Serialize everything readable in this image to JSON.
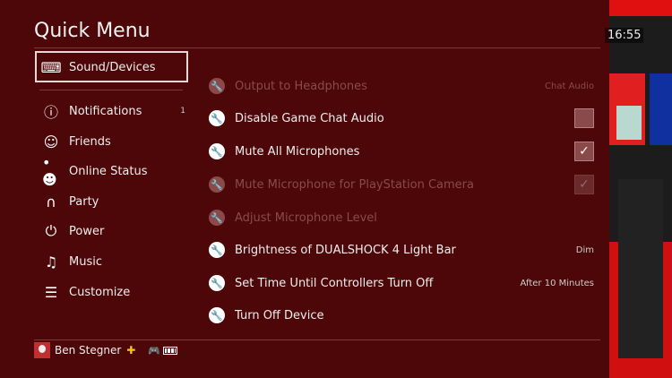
{
  "header": {
    "title": "Quick Menu",
    "time": "16:55"
  },
  "sidebar": {
    "selected": {
      "label": "Sound/Devices",
      "icon": "keyboard-controller-icon"
    },
    "items": [
      {
        "label": "Notifications",
        "icon": "info-icon",
        "badge": "1"
      },
      {
        "label": "Friends",
        "icon": "friends-icon"
      },
      {
        "label": "Online Status",
        "icon": "online-status-icon"
      },
      {
        "label": "Party",
        "icon": "headset-icon"
      },
      {
        "label": "Power",
        "icon": "power-icon"
      },
      {
        "label": "Music",
        "icon": "music-note-icon"
      },
      {
        "label": "Customize",
        "icon": "customize-icon"
      }
    ]
  },
  "settings": [
    {
      "label": "Output to Headphones",
      "value": "Chat Audio",
      "disabled": true
    },
    {
      "label": "Disable Game Chat Audio",
      "checkbox": false
    },
    {
      "label": "Mute All Microphones",
      "checkbox": true
    },
    {
      "label": "Mute Microphone for PlayStation Camera",
      "checkbox": true,
      "disabled": true
    },
    {
      "label": "Adjust Microphone Level",
      "disabled": true
    },
    {
      "label": "Brightness of DUALSHOCK 4 Light Bar",
      "value": "Dim"
    },
    {
      "label": "Set Time Until Controllers Turn Off",
      "value": "After 10 Minutes"
    },
    {
      "label": "Turn Off Device"
    }
  ],
  "footer": {
    "user": "Ben Stegner",
    "plus_icon": "playstation-plus-icon",
    "controller_icon": "controller-icon",
    "battery_icon": "battery-icon",
    "battery_level": "full"
  },
  "colors": {
    "background": "#4e0708",
    "plus": "#f5c518"
  }
}
